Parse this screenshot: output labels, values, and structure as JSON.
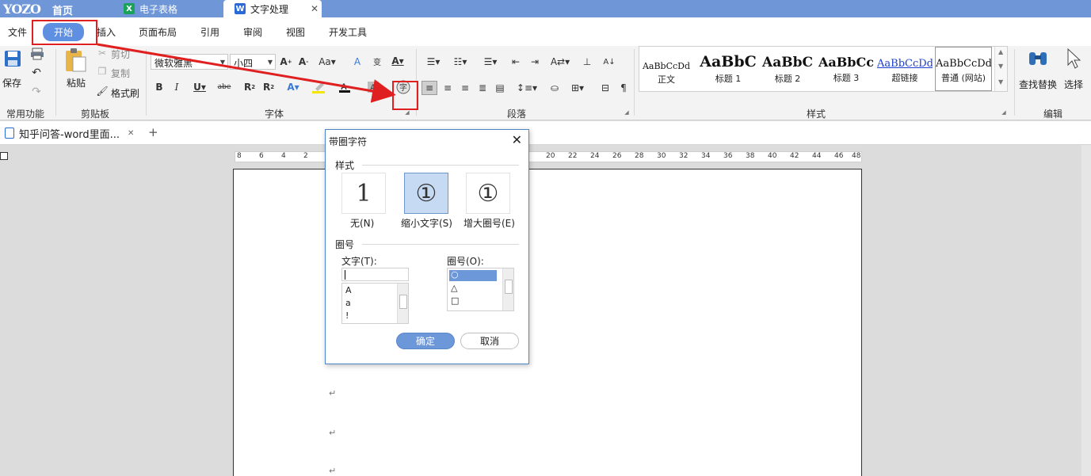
{
  "titlebar": {
    "logo": "YOZO",
    "home": "首页",
    "tabs": [
      {
        "label": "电子表格",
        "icon": "spreadsheet-icon"
      },
      {
        "label": "文字处理",
        "icon": "word-icon",
        "close": "✕"
      }
    ]
  },
  "menu": {
    "items": [
      "文件",
      "开始",
      "插入",
      "页面布局",
      "引用",
      "审阅",
      "视图",
      "开发工具"
    ],
    "active": "开始"
  },
  "ribbon": {
    "common": {
      "save": "保存",
      "group": "常用功能"
    },
    "clipboard": {
      "paste": "粘贴",
      "cut": "剪切",
      "copy": "复制",
      "format_painter": "格式刷",
      "group": "剪贴板"
    },
    "font": {
      "name": "微软雅黑",
      "size": "小四",
      "group": "字体"
    },
    "paragraph": {
      "group": "段落"
    },
    "styles": {
      "group": "样式",
      "items": [
        {
          "sample": "AaBbCcDd",
          "name": "正文"
        },
        {
          "sample": "AaBbC",
          "name": "标题 1"
        },
        {
          "sample": "AaBbC",
          "name": "标题 2"
        },
        {
          "sample": "AaBbCcI",
          "name": "标题 3"
        },
        {
          "sample": "AaBbCcDd",
          "name": "超链接"
        },
        {
          "sample": "AaBbCcDd",
          "name": "普通 (网站)"
        }
      ]
    },
    "edit": {
      "find_replace": "查找替换",
      "select": "选择",
      "group": "编辑"
    }
  },
  "doc_tab": {
    "title": "知乎问答-word里面...",
    "close": "✕",
    "add": "+"
  },
  "ruler": {
    "numbers": [
      "8",
      "6",
      "4",
      "2",
      "20",
      "22",
      "24",
      "26",
      "28",
      "30",
      "32",
      "34",
      "36",
      "38",
      "40",
      "42",
      "44",
      "46",
      "48"
    ]
  },
  "document": {
    "paragraph_mark": "↵"
  },
  "dialog": {
    "title": "带圈字符",
    "style_section": "样式",
    "styles": [
      {
        "glyph": "1",
        "label": "无(N)"
      },
      {
        "glyph": "①",
        "label": "缩小文字(S)"
      },
      {
        "glyph": "①",
        "label": "增大圈号(E)"
      }
    ],
    "selected_style": "缩小文字(S)",
    "circle_section": "圈号",
    "text_label": "文字(T):",
    "text_value": "",
    "text_options": [
      "A",
      "a",
      "!"
    ],
    "circle_label": "圈号(O):",
    "circle_options": [
      "○",
      "△",
      "□"
    ],
    "ok": "确定",
    "cancel": "取消"
  },
  "colors": {
    "titlebar": "#6f97d8",
    "accent": "#5f8fe0",
    "annotation": "#e02020"
  }
}
